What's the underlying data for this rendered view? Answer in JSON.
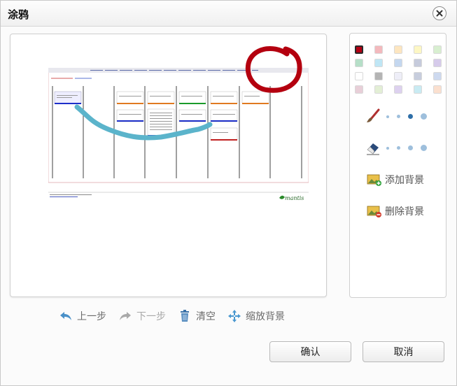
{
  "dialog": {
    "title": "涂鸦"
  },
  "palette": {
    "selected_index": 0,
    "colors": [
      "#b40014",
      "#f3b9bd",
      "#fde6c0",
      "#fdf7c4",
      "#d8efd0",
      "#b6dfc8",
      "#bfe6f5",
      "#c4d7ef",
      "#c6cbdc",
      "#d6cbeb",
      "#ffffff",
      "#b4b4b4",
      "#eeeef8",
      "#c7cddd",
      "#cdd9ef",
      "#e8cfd8",
      "#e3efd5",
      "#ddd1ef",
      "#c9ebf3",
      "#fbe0cf"
    ]
  },
  "brush": {
    "icon": "brush-icon",
    "selected_size_index": 2
  },
  "eraser": {
    "icon": "eraser-icon",
    "selected_size_index": null
  },
  "side_actions": {
    "add_background": "添加背景",
    "remove_background": "删除背景"
  },
  "bottom_actions": {
    "undo": "上一步",
    "redo": "下一步",
    "clear": "清空",
    "scale_background": "缩放背景"
  },
  "buttons": {
    "confirm": "确认",
    "cancel": "取消"
  },
  "background_image": {
    "logo_text": "mantis",
    "columns": [
      "",
      "new",
      "feedback",
      "acknowledged",
      "confirmed",
      "assigned",
      "resolved",
      "closed"
    ]
  }
}
